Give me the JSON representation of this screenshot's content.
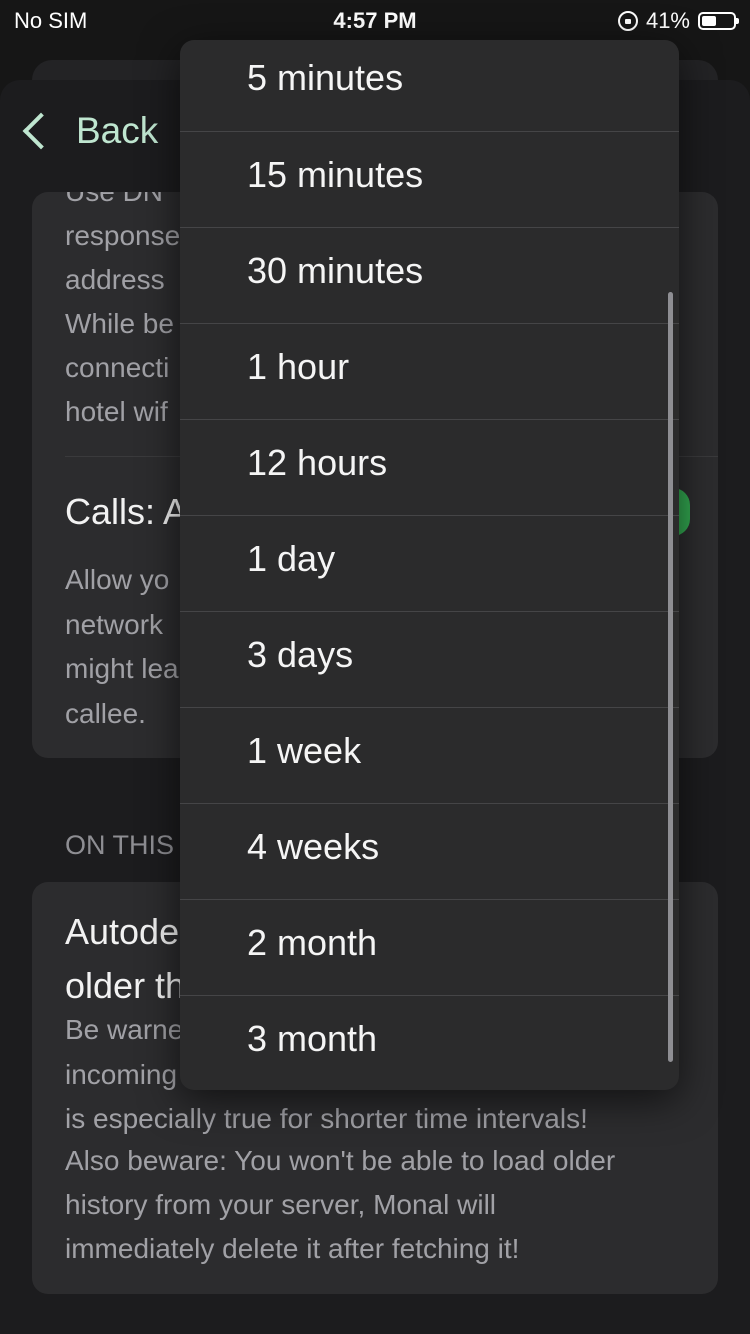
{
  "status_bar": {
    "carrier": "No SIM",
    "time": "4:57 PM",
    "battery": "41%"
  },
  "nav": {
    "back_label": "Back"
  },
  "card1": {
    "top_text": "Use DN",
    "desc_lines": [
      "response",
      "address",
      "While be",
      "connecti",
      "hotel wif"
    ],
    "calls_title": "Calls: A",
    "calls_lines": [
      "Allow yo",
      "network",
      "might lea",
      "callee."
    ]
  },
  "section_header": "ON THIS",
  "card2": {
    "title_lines": [
      "Autode",
      "older th"
    ],
    "desc_lines": [
      "Be warne",
      "incoming",
      "is especially true for shorter time intervals!",
      "Also beware: You won't be able to load older",
      "history from your server, Monal will",
      "immediately delete it after fetching it!"
    ]
  },
  "menu": {
    "items": [
      "5 minutes",
      "15 minutes",
      "30 minutes",
      "1 hour",
      "12 hours",
      "1 day",
      "3 days",
      "1 week",
      "4 weeks",
      "2 month",
      "3 month"
    ]
  },
  "colors": {
    "accent": "#bfe6d0",
    "toggle_on": "#34c759"
  }
}
